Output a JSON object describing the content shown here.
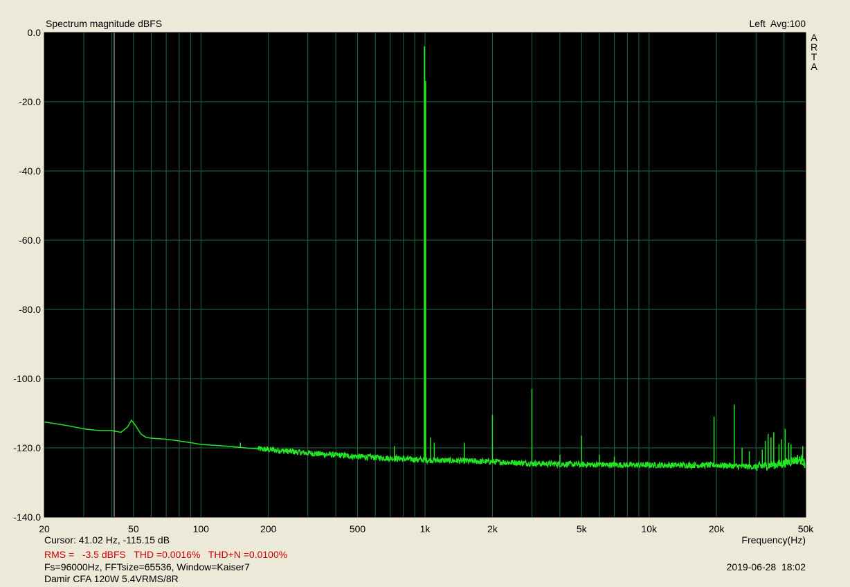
{
  "header": {
    "title": "Spectrum magnitude dBFS",
    "channel_avg": "Left  Avg:100"
  },
  "brand": "ARTA",
  "footer": {
    "cursor": "Cursor: 41.02 Hz, -115.15 dB",
    "stats": "RMS =   -3.5 dBFS   THD =0.0016%   THD+N =0.0100%",
    "fft": "Fs=96000Hz, FFTsize=65536, Window=Kaiser7",
    "description": "Damir CFA 120W 5.4VRMS/8R",
    "datetime": "2019-06-28  18:02"
  },
  "colors": {
    "trace": "#22E622",
    "grid": "#1E6B3C",
    "background": "#000000",
    "cursor": "#C8C8C8",
    "frame": "#ECE9D8"
  },
  "chart_data": {
    "type": "line",
    "x_scale": "log",
    "xlim": [
      20,
      50000
    ],
    "ylim": [
      -140,
      0
    ],
    "xlabel": "Frequency(Hz)",
    "x_ticks": [
      {
        "v": 20,
        "label": "20"
      },
      {
        "v": 50,
        "label": "50"
      },
      {
        "v": 100,
        "label": "100"
      },
      {
        "v": 200,
        "label": "200"
      },
      {
        "v": 500,
        "label": "500"
      },
      {
        "v": 1000,
        "label": "1k"
      },
      {
        "v": 2000,
        "label": "2k"
      },
      {
        "v": 5000,
        "label": "5k"
      },
      {
        "v": 10000,
        "label": "10k"
      },
      {
        "v": 20000,
        "label": "20k"
      },
      {
        "v": 50000,
        "label": "50k"
      }
    ],
    "y_ticks": [
      {
        "v": 0,
        "label": "0.0"
      },
      {
        "v": -20,
        "label": "-20.0"
      },
      {
        "v": -40,
        "label": "-40.0"
      },
      {
        "v": -60,
        "label": "-60.0"
      },
      {
        "v": -80,
        "label": "-80.0"
      },
      {
        "v": -100,
        "label": "-100.0"
      },
      {
        "v": -120,
        "label": "-120.0"
      },
      {
        "v": -140,
        "label": "-140.0"
      }
    ],
    "cursor_x": 41.02,
    "noise_floor": [
      [
        20,
        -112.5
      ],
      [
        25,
        -113.5
      ],
      [
        30,
        -114.5
      ],
      [
        35,
        -115
      ],
      [
        40,
        -115
      ],
      [
        44,
        -115.5
      ],
      [
        47,
        -114
      ],
      [
        49,
        -112
      ],
      [
        51,
        -113.5
      ],
      [
        54,
        -116
      ],
      [
        57,
        -117
      ],
      [
        60,
        -117.2
      ],
      [
        70,
        -117.5
      ],
      [
        80,
        -118
      ],
      [
        90,
        -118.5
      ],
      [
        100,
        -119
      ],
      [
        130,
        -119.5
      ],
      [
        170,
        -120.2
      ],
      [
        200,
        -120.5
      ],
      [
        300,
        -121.5
      ],
      [
        500,
        -122.5
      ],
      [
        800,
        -123.2
      ],
      [
        1000,
        -123.5
      ],
      [
        2000,
        -124
      ],
      [
        3000,
        -124.5
      ],
      [
        5000,
        -124.8
      ],
      [
        10000,
        -125
      ],
      [
        20000,
        -125
      ],
      [
        30000,
        -125.5
      ],
      [
        40000,
        -124.5
      ],
      [
        45000,
        -123.5
      ],
      [
        48000,
        -123.5
      ],
      [
        50000,
        -125
      ]
    ],
    "peaks": [
      {
        "f": 150,
        "db": -118.5
      },
      {
        "f": 730,
        "db": -119.5
      },
      {
        "f": 995,
        "db": -4.0
      },
      {
        "f": 1005,
        "db": -14.0
      },
      {
        "f": 1060,
        "db": -117.0
      },
      {
        "f": 1100,
        "db": -118.5
      },
      {
        "f": 1500,
        "db": -118.5
      },
      {
        "f": 2000,
        "db": -110.5
      },
      {
        "f": 3000,
        "db": -103.0
      },
      {
        "f": 4000,
        "db": -122.0
      },
      {
        "f": 5000,
        "db": -116.5
      },
      {
        "f": 6000,
        "db": -122.0
      },
      {
        "f": 7000,
        "db": -122.5
      },
      {
        "f": 19500,
        "db": -111.0
      },
      {
        "f": 24000,
        "db": -107.5
      },
      {
        "f": 26000,
        "db": -120.0
      },
      {
        "f": 28000,
        "db": -121.0
      },
      {
        "f": 32000,
        "db": -120.5
      },
      {
        "f": 33000,
        "db": -118.0
      },
      {
        "f": 34000,
        "db": -116.0
      },
      {
        "f": 35000,
        "db": -117.0
      },
      {
        "f": 36000,
        "db": -115.5
      },
      {
        "f": 38000,
        "db": -119.0
      },
      {
        "f": 39000,
        "db": -117.5
      },
      {
        "f": 40500,
        "db": -114.5
      },
      {
        "f": 42000,
        "db": -118.5
      },
      {
        "f": 43000,
        "db": -119.0
      },
      {
        "f": 46000,
        "db": -122.0
      },
      {
        "f": 48500,
        "db": -119.5
      }
    ]
  }
}
